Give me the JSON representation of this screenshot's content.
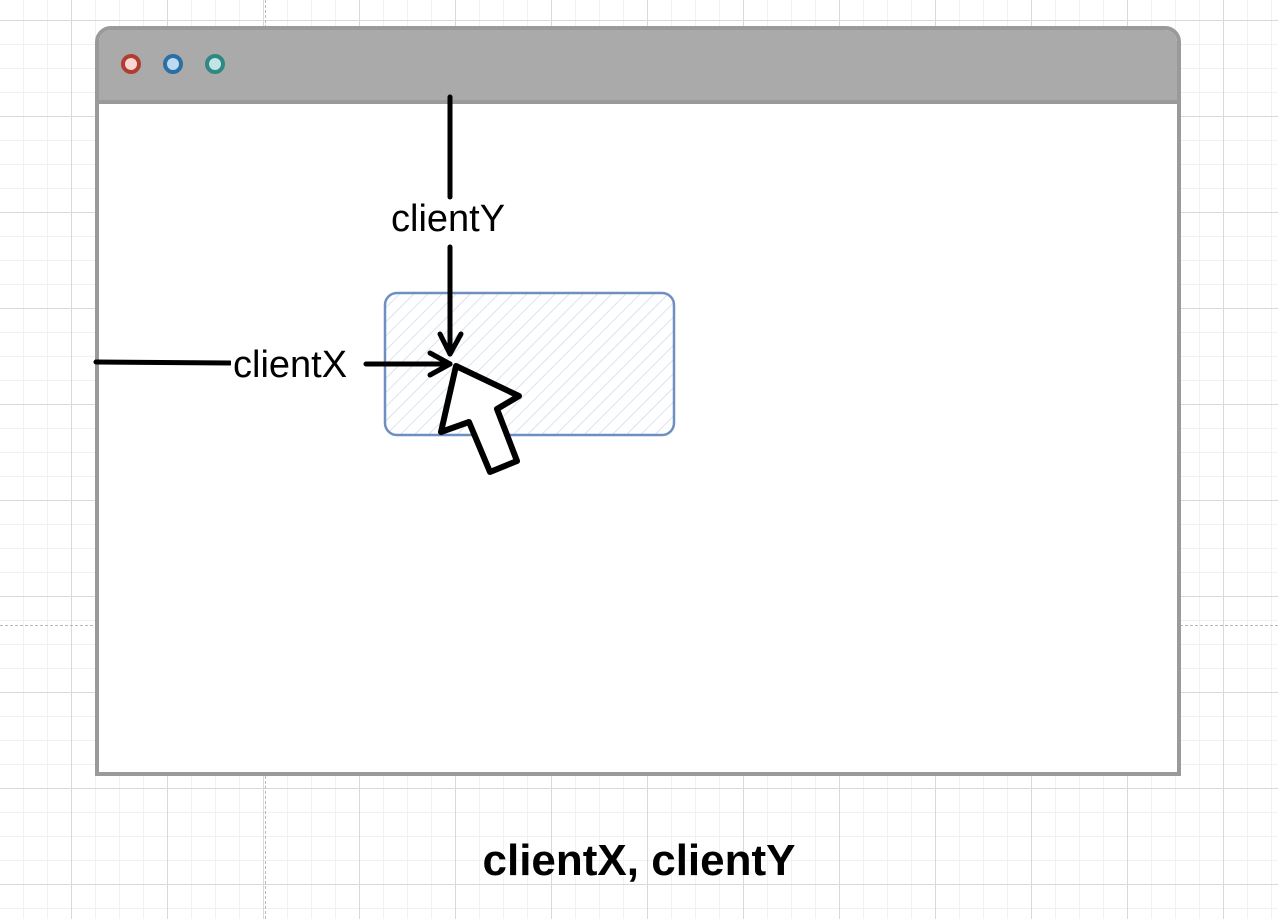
{
  "diagram": {
    "caption": "clientX, clientY",
    "label_y": "clientY",
    "label_x": "clientX"
  },
  "window_controls": {
    "close": {
      "fill": "#f8d7d3",
      "stroke": "#b23c32"
    },
    "minimize": {
      "fill": "#bcdaf3",
      "stroke": "#2c6fa3"
    },
    "maximize": {
      "fill": "#bfe6e4",
      "stroke": "#2f8884"
    }
  },
  "colors": {
    "window_border": "#9a9a9a",
    "titlebar": "#aaaaaa",
    "target_stroke": "#6f8fc0",
    "target_hatch": "#cdd9ef",
    "arrow": "#000000"
  },
  "icons": [
    "close-dot-icon",
    "minimize-dot-icon",
    "maximize-dot-icon",
    "mouse-pointer-icon",
    "arrow-down-icon",
    "arrow-right-icon"
  ]
}
